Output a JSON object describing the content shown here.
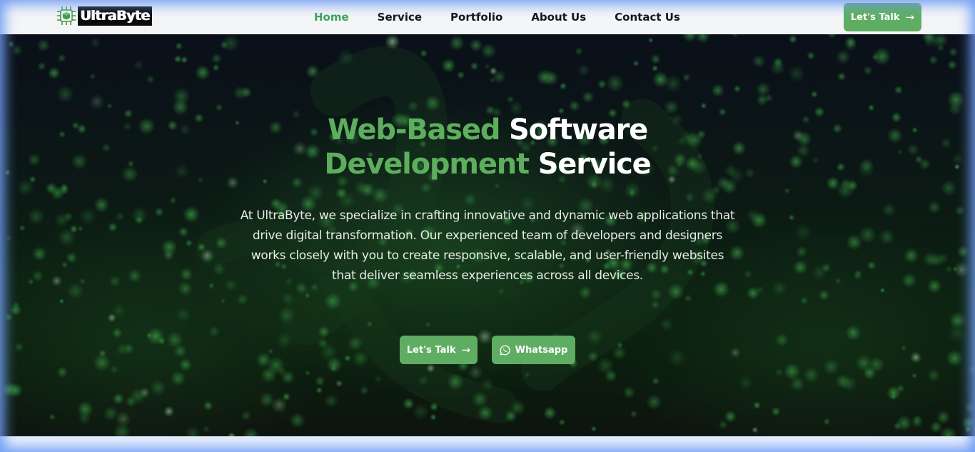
{
  "brand": {
    "name": "UltraByte",
    "accent_color": "#5fad63",
    "active_nav_color": "#3aa35d",
    "logo_icon": "circuit-chip-icon"
  },
  "nav": {
    "items": [
      {
        "label": "Home",
        "active": true
      },
      {
        "label": "Service",
        "active": false
      },
      {
        "label": "Portfolio",
        "active": false
      },
      {
        "label": "About Us",
        "active": false
      },
      {
        "label": "Contact Us",
        "active": false
      }
    ],
    "cta_label": "Let's Talk",
    "cta_icon": "arrow-right-icon"
  },
  "hero": {
    "title_line1_accent": "Web-Based",
    "title_line1_rest": "Software",
    "title_line2_accent": "Development",
    "title_line2_rest": "Service",
    "description": "At UltraByte, we specialize in crafting innovative and dynamic web applications that drive digital transformation. Our experienced team of developers and designers works closely with you to create responsive, scalable, and user-friendly websites that deliver seamless experiences across all devices.",
    "primary_button_label": "Let's Talk",
    "primary_button_icon": "arrow-right-icon",
    "secondary_button_label": "Whatsapp",
    "secondary_button_icon": "whatsapp-icon"
  }
}
